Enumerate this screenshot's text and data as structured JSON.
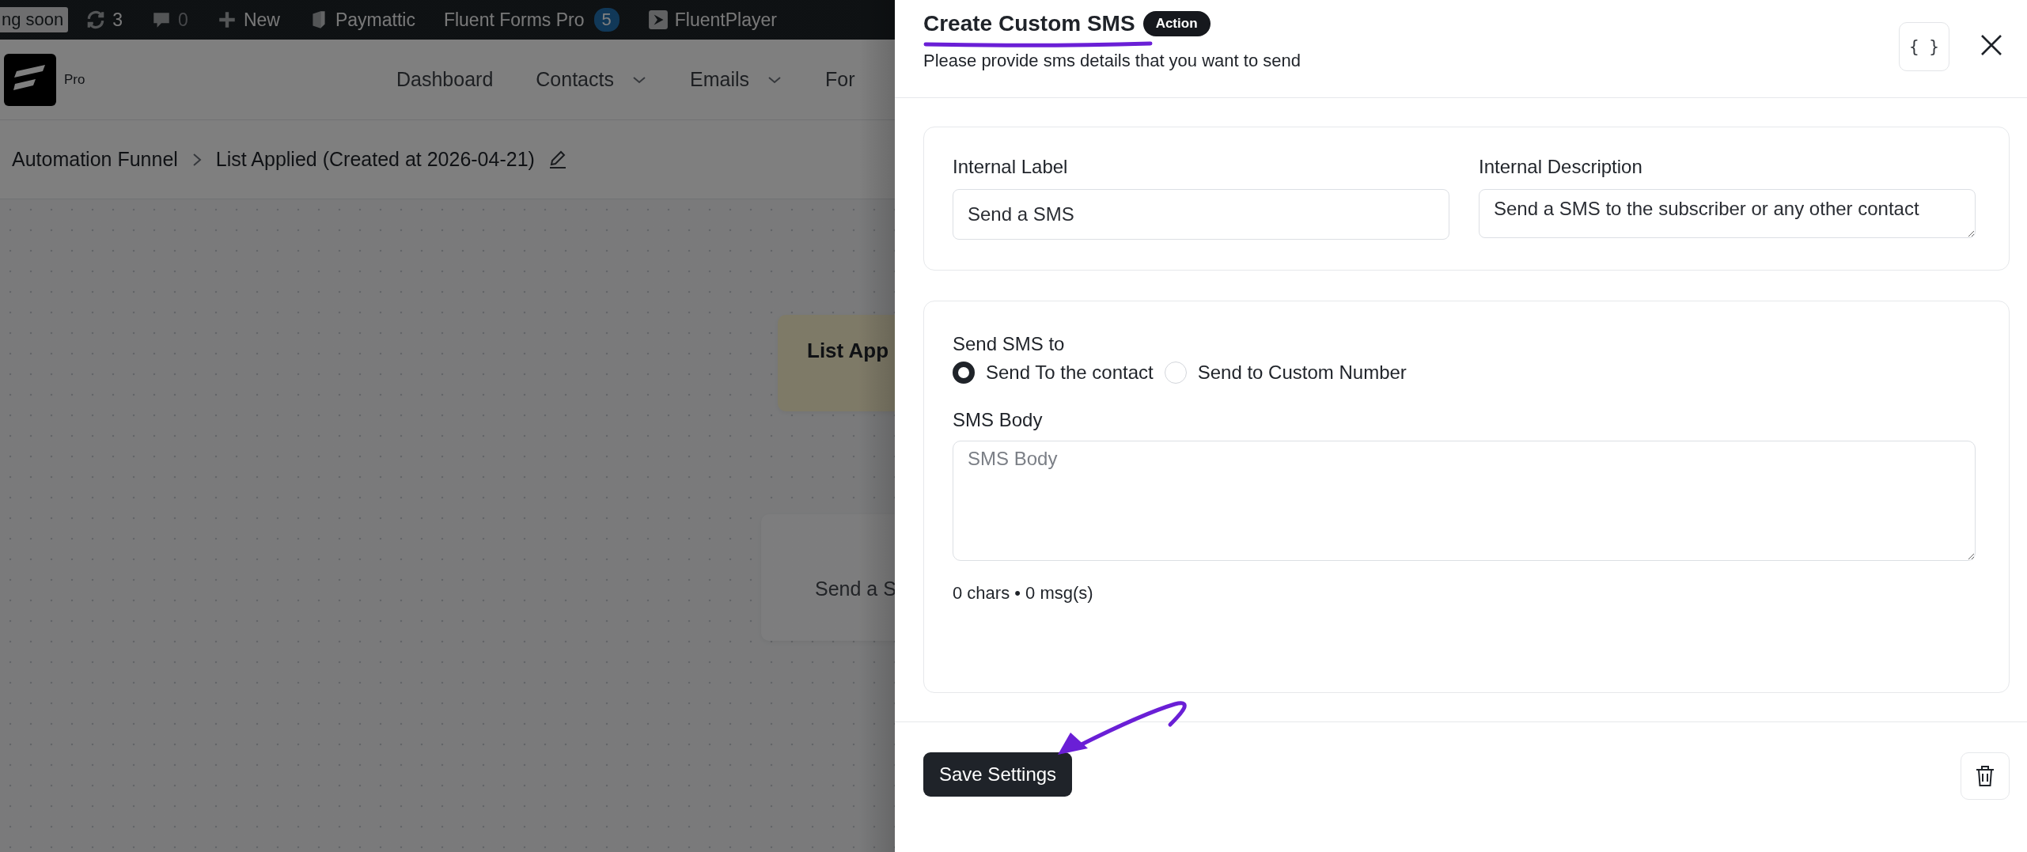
{
  "admin_bar": {
    "items": [
      {
        "kind": "badge",
        "label": "ng soon"
      },
      {
        "kind": "updates",
        "label": "3"
      },
      {
        "kind": "comments",
        "label": "0"
      },
      {
        "kind": "new",
        "label": "New"
      },
      {
        "kind": "paymattic",
        "label": "Paymattic"
      },
      {
        "kind": "plugin",
        "label": "Fluent Forms Pro",
        "count": "5"
      },
      {
        "kind": "player",
        "label": "FluentPlayer"
      }
    ]
  },
  "header": {
    "logo_text": "Pro",
    "nav": [
      {
        "label": "Dashboard",
        "dropdown": false
      },
      {
        "label": "Contacts",
        "dropdown": true
      },
      {
        "label": "Emails",
        "dropdown": true
      },
      {
        "label": "For",
        "dropdown": false
      }
    ]
  },
  "breadcrumb": {
    "items": [
      "Automation Funnel",
      "List Applied (Created at 2026-04-21)"
    ]
  },
  "canvas": {
    "nodes": [
      {
        "kind": "trigger",
        "title": "List App"
      },
      {
        "kind": "action",
        "title": "Send a S"
      }
    ]
  },
  "drawer": {
    "title": "Create Custom SMS",
    "badge": "Action",
    "subtitle": "Please provide sms details that you want to send",
    "braces_button": "{ }",
    "internal_label": {
      "label": "Internal Label",
      "value": "Send a SMS"
    },
    "internal_description": {
      "label": "Internal Description",
      "value": "Send a SMS to the subscriber or any other contact"
    },
    "send_to": {
      "label": "Send SMS to",
      "options": [
        {
          "label": "Send To the contact",
          "selected": true
        },
        {
          "label": "Send to Custom Number",
          "selected": false
        }
      ]
    },
    "sms_body": {
      "label": "SMS Body",
      "placeholder": "SMS Body"
    },
    "counter": "0 chars • 0 msg(s)",
    "save_button": "Save Settings"
  }
}
